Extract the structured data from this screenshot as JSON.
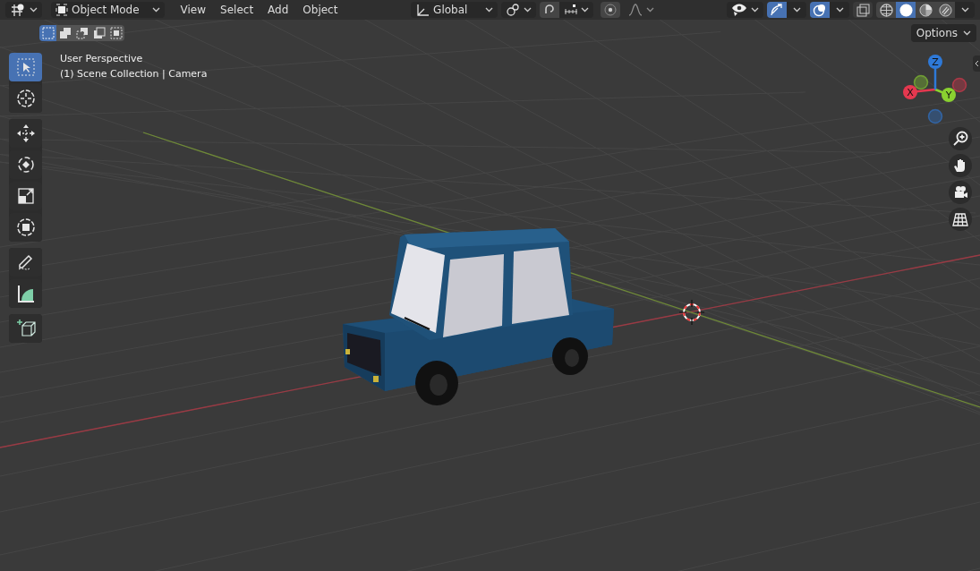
{
  "header": {
    "mode": "Object Mode",
    "menus": [
      "View",
      "Select",
      "Add",
      "Object"
    ],
    "orientation": "Global",
    "snap": {
      "selected": false
    },
    "proportional": {
      "selected": false
    },
    "gizmos": {
      "selected": true
    },
    "overlays": {
      "selected": true
    },
    "xray": {
      "selected": false
    },
    "shading": [
      {
        "kind": "wireframe",
        "selected": false
      },
      {
        "kind": "solid",
        "selected": true
      },
      {
        "kind": "material",
        "selected": false
      },
      {
        "kind": "rendered",
        "selected": false
      }
    ]
  },
  "select_modes": [
    {
      "kind": "set",
      "selected": true
    },
    {
      "kind": "extend",
      "selected": false
    },
    {
      "kind": "subtract",
      "selected": false
    },
    {
      "kind": "invert",
      "selected": false
    },
    {
      "kind": "intersect",
      "selected": false
    }
  ],
  "options": "Options",
  "viewport": {
    "perspective": "User Perspective",
    "collection": "(1) Scene Collection | Camera"
  },
  "tool_groups": [
    [
      {
        "kind": "select",
        "selected": true
      },
      {
        "kind": "cursor",
        "selected": false
      }
    ],
    [
      {
        "kind": "move",
        "selected": false
      },
      {
        "kind": "rotate",
        "selected": false
      },
      {
        "kind": "scale",
        "selected": false
      },
      {
        "kind": "transform",
        "selected": false
      }
    ],
    [
      {
        "kind": "annotate",
        "selected": false
      },
      {
        "kind": "measure",
        "selected": false
      }
    ],
    [
      {
        "kind": "add_cube",
        "selected": false
      }
    ]
  ],
  "gizmo": {
    "axes": [
      {
        "label": "X",
        "color": "#e5384f"
      },
      {
        "label": "Y",
        "color": "#8ad130"
      },
      {
        "label": "Z",
        "color": "#2e79d8"
      }
    ]
  },
  "nav": [
    {
      "kind": "zoom"
    },
    {
      "kind": "pan"
    },
    {
      "kind": "camera"
    },
    {
      "kind": "ortho"
    }
  ]
}
